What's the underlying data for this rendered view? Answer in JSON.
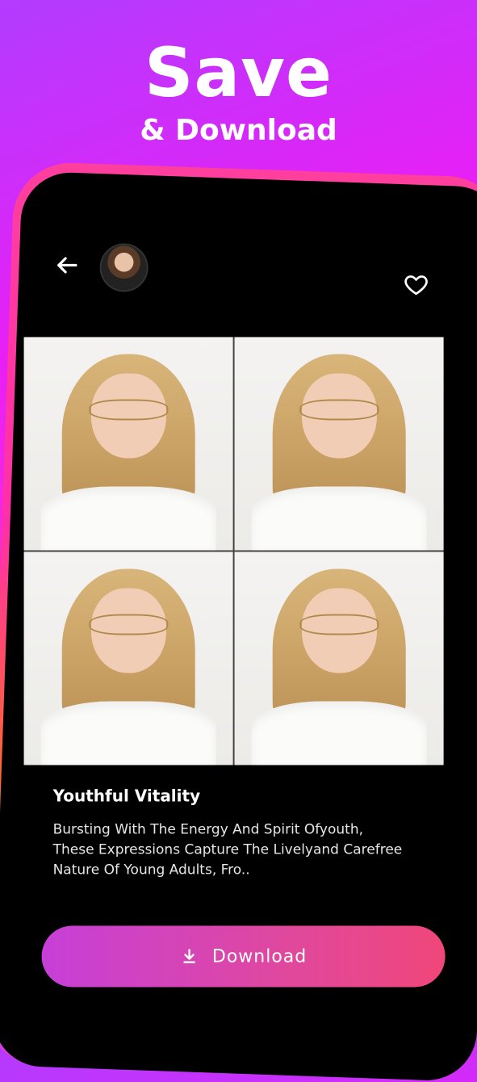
{
  "hero": {
    "title": "Save",
    "subtitle": "& Download"
  },
  "header": {
    "back_icon": "arrow-left-icon",
    "avatar": "user-avatar",
    "favorite_icon": "heart-outline-icon"
  },
  "gallery": {
    "photos": [
      {
        "name": "photo-surprised"
      },
      {
        "name": "photo-pointing"
      },
      {
        "name": "photo-winking"
      },
      {
        "name": "photo-shy"
      }
    ]
  },
  "details": {
    "title": "Youthful Vitality",
    "description": "Bursting With The Energy And Spirit Ofyouth, These Expressions Capture The Livelyand Carefree Nature Of Young Adults, Fro.."
  },
  "actions": {
    "download_label": "Download",
    "download_icon": "download-icon"
  },
  "colors": {
    "background_accent": "#e81ff5",
    "button_start": "#c63fd8",
    "button_end": "#f0477a"
  }
}
